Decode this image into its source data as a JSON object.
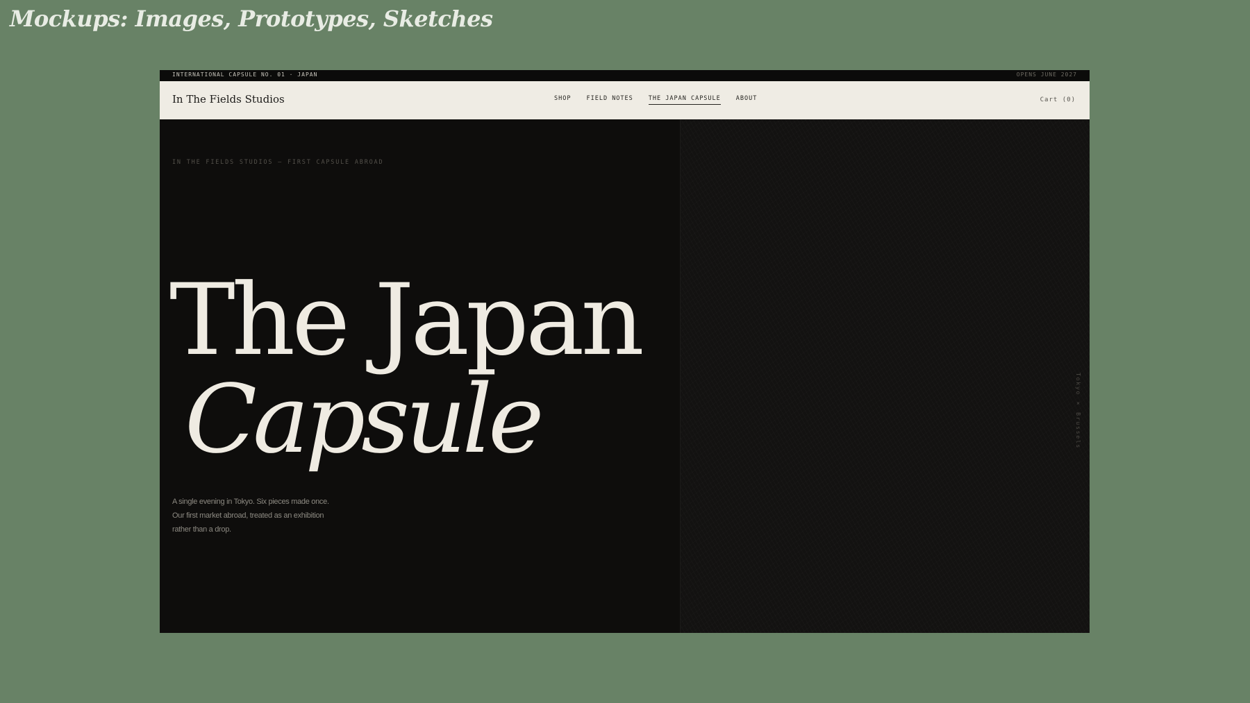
{
  "slide": {
    "title": "Mockups: Images, Prototypes, Sketches",
    "background_color": "#688266"
  },
  "site": {
    "announcement_left": "INTERNATIONAL CAPSULE NO. 01 · JAPAN",
    "announcement_right": "OPENS JUNE 2027",
    "brand": "In The Fields Studios",
    "nav_items": [
      {
        "label": "SHOP",
        "active": false
      },
      {
        "label": "FIELD NOTES",
        "active": false
      },
      {
        "label": "THE JAPAN CAPSULE",
        "active": true
      },
      {
        "label": "ABOUT",
        "active": false
      }
    ],
    "cart_label": "Cart (0)"
  },
  "hero": {
    "eyebrow": "IN THE FIELDS STUDIOS — FIRST CAPSULE ABROAD",
    "headline_line1": "The Japan",
    "headline_line2": "Capsule",
    "intro": "A single evening in Tokyo. Six pieces made once. Our first market abroad, treated as an exhibition rather than a drop.",
    "vertical_caption": "Tokyo × Brussels",
    "background_color": "#0e0d0c",
    "text_color": "#efebe2"
  }
}
